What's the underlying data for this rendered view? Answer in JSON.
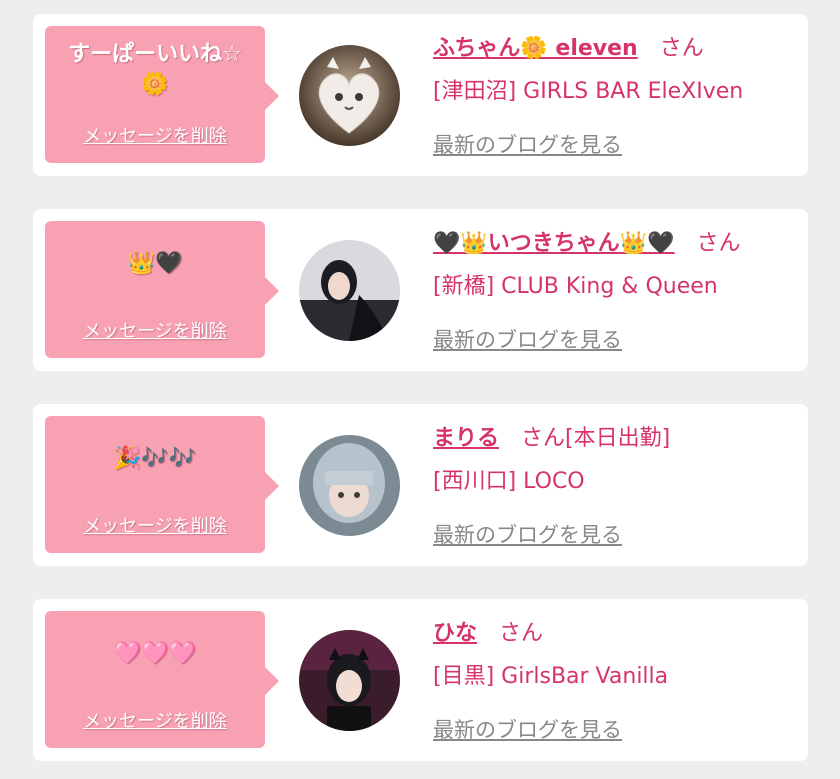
{
  "delete_label": "メッセージを削除",
  "blog_label": "最新のブログを見る",
  "colors": {
    "page_bg": "#eeeeee",
    "card_bg": "#ffffff",
    "bubble_bg": "#f7a1b3",
    "accent": "#d6336c",
    "link_gray": "#888888"
  },
  "favorites": [
    {
      "message": "すーぱーいいね☆ 🌼",
      "name": "ふちゃん🌼 eleven",
      "suffix": "さん",
      "shop": "[津田沼] GIRLS BAR EleXIven",
      "avatar_icon": "heart-cat-photo"
    },
    {
      "message": "👑🖤",
      "name": "🖤👑いつきちゃん👑🖤",
      "suffix": "さん",
      "shop": "[新橋] CLUB King & Queen",
      "avatar_icon": "portrait-photo"
    },
    {
      "message": "🎉🎶🎶",
      "name": "まりる",
      "suffix": "さん[本日出勤]",
      "shop": "[西川口] LOCO",
      "avatar_icon": "portrait-photo"
    },
    {
      "message": "🩷🩷🩷",
      "name": "ひな",
      "suffix": "さん",
      "shop": "[目黒] GirlsBar Vanilla",
      "avatar_icon": "portrait-photo"
    }
  ]
}
